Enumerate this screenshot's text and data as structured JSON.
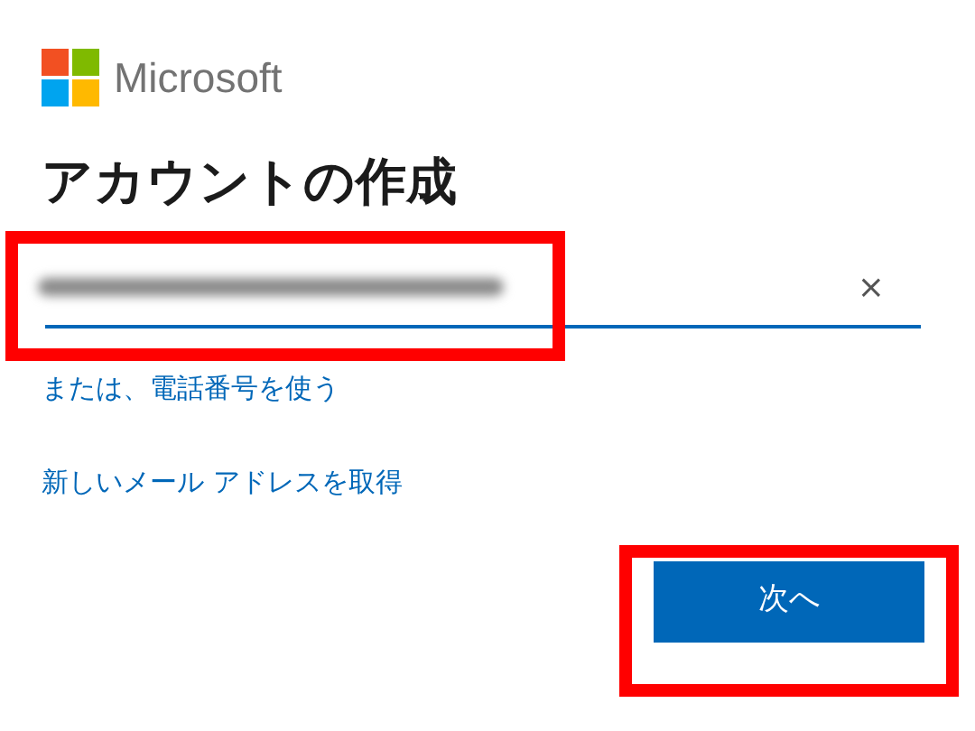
{
  "brand": "Microsoft",
  "heading": "アカウントの作成",
  "email_field": {
    "clear_button": "×"
  },
  "links": [
    "または、電話番号を使う",
    "新しいメール アドレスを取得"
  ],
  "next_button": "次へ"
}
